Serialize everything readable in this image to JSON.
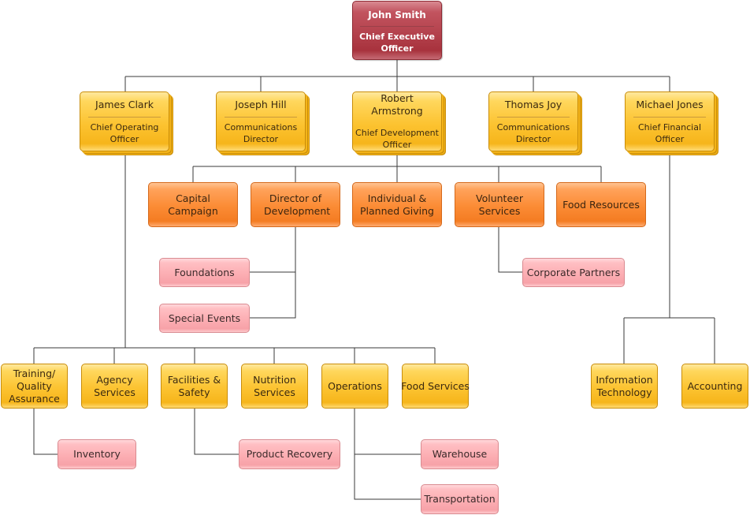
{
  "chart": {
    "ceo": {
      "name": "John Smith",
      "title": "Chief Executive Officer"
    },
    "executives": [
      {
        "name": "James Clark",
        "title": "Chief Operating Officer"
      },
      {
        "name": "Joseph Hill",
        "title": "Communications Director"
      },
      {
        "name": "Robert Armstrong",
        "title": "Chief Development Officer"
      },
      {
        "name": "Thomas Joy",
        "title": "Communications Director"
      },
      {
        "name": "Michael Jones",
        "title": "Chief Financial Officer"
      }
    ],
    "development_units": [
      {
        "label": "Capital Campaign"
      },
      {
        "label": "Director of Development",
        "children": [
          "Foundations",
          "Special Events"
        ]
      },
      {
        "label": "Individual & Planned Giving"
      },
      {
        "label": "Volunteer Services",
        "children": [
          "Corporate Partners"
        ]
      },
      {
        "label": "Food Resources"
      }
    ],
    "operations_units": [
      {
        "label": "Training/ Quality Assurance",
        "children": [
          "Inventory"
        ]
      },
      {
        "label": "Agency Services"
      },
      {
        "label": "Facilities & Safety",
        "children": [
          "Product Recovery"
        ]
      },
      {
        "label": "Nutrition Services"
      },
      {
        "label": "Operations",
        "children": [
          "Warehouse",
          "Transportation"
        ]
      },
      {
        "label": "Food Services"
      }
    ],
    "finance_units": [
      {
        "label": "Information Technology"
      },
      {
        "label": "Accounting"
      }
    ]
  },
  "colors": {
    "ceo": "#b4424d",
    "executive": "#fcc331",
    "department": "#fb8b34",
    "unit": "#fcc331",
    "leaf": "#fcaeb3",
    "connector": "#3a3a3a"
  }
}
